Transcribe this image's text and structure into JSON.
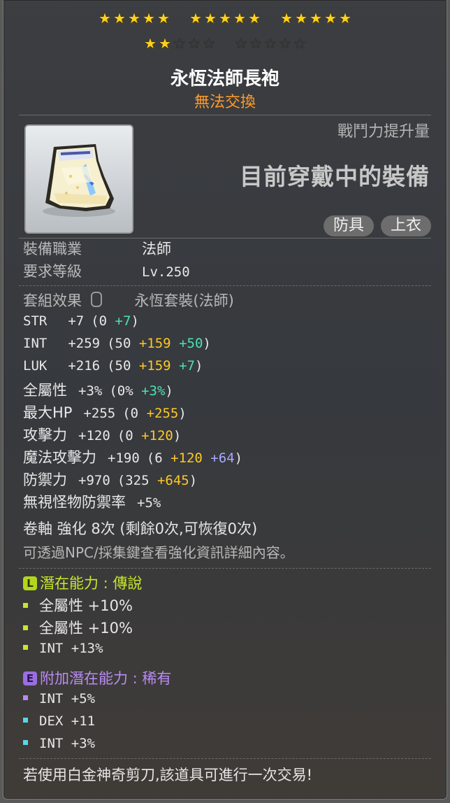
{
  "stars": {
    "total": 25,
    "filled": 17
  },
  "item": {
    "name": "永恆法師長袍",
    "trade_status": "無法交換",
    "cp_label": "戰鬥力提升量",
    "equipped_text": "目前穿戴中的裝備",
    "tags": [
      "防具",
      "上衣"
    ]
  },
  "requirements": {
    "job_label": "裝備職業",
    "job_value": "法師",
    "level_label": "要求等級",
    "level_value": "Lv.250"
  },
  "set": {
    "label": "套組效果",
    "value": "永恆套裝(法師)"
  },
  "stats": [
    {
      "name": "STR",
      "total": "+7",
      "open": "(0",
      "parts": [
        {
          "v": "+7",
          "c": "green"
        }
      ],
      "close": ")"
    },
    {
      "name": "INT",
      "total": "+259",
      "open": "(50",
      "parts": [
        {
          "v": "+159",
          "c": "yellow"
        },
        {
          "v": "+50",
          "c": "green"
        }
      ],
      "close": ")"
    },
    {
      "name": "LUK",
      "total": "+216",
      "open": "(50",
      "parts": [
        {
          "v": "+159",
          "c": "yellow"
        },
        {
          "v": "+7",
          "c": "green"
        }
      ],
      "close": ")"
    },
    {
      "name": "全屬性",
      "total": "+3%",
      "open": "(0%",
      "parts": [
        {
          "v": "+3%",
          "c": "green"
        }
      ],
      "close": ")"
    },
    {
      "name": "最大HP",
      "total": "+255",
      "open": "(0",
      "parts": [
        {
          "v": "+255",
          "c": "yellow"
        }
      ],
      "close": ")"
    },
    {
      "name": "攻擊力",
      "total": "+120",
      "open": "(0",
      "parts": [
        {
          "v": "+120",
          "c": "yellow"
        }
      ],
      "close": ")"
    },
    {
      "name": "魔法攻擊力",
      "total": "+190",
      "open": "(6",
      "parts": [
        {
          "v": "+120",
          "c": "yellow"
        },
        {
          "v": "+64",
          "c": "blue"
        }
      ],
      "close": ")"
    },
    {
      "name": "防禦力",
      "total": "+970",
      "open": "(325",
      "parts": [
        {
          "v": "+645",
          "c": "yellow"
        }
      ],
      "close": ")"
    },
    {
      "name": "無視怪物防禦率",
      "total": "+5%",
      "open": "",
      "parts": [],
      "close": ""
    }
  ],
  "scroll_text": "卷軸 強化 8次 (剩餘0次,可恢復0次)",
  "npc_hint": "可透過NPC/採集鍵查看強化資訊詳細內容。",
  "potential": {
    "badge": "L",
    "label": "潛在能力 : 傳說",
    "lines": [
      "全屬性 +10%",
      "全屬性 +10%",
      "INT +13%"
    ],
    "color": "#c8e62a"
  },
  "bonus_potential": {
    "badge": "E",
    "label": "附加潛在能力 : 稀有",
    "lines": [
      "INT +5%",
      "DEX +11",
      "INT +3%"
    ],
    "bullet_colors": [
      "#b888f0",
      "#58d8e8",
      "#58d8e8"
    ],
    "color": "#b98cf2"
  },
  "footer": "若使用白金神奇剪刀,該道具可進行一次交易!"
}
